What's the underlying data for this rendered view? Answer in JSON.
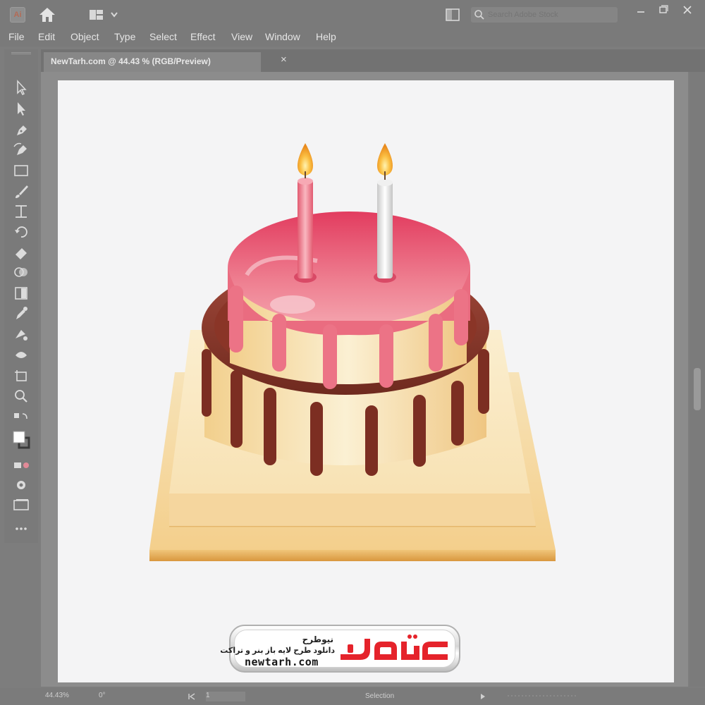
{
  "app": {
    "logo_text": "Ai"
  },
  "search": {
    "placeholder": "Search Adobe Stock"
  },
  "menu": [
    "File",
    "Edit",
    "Object",
    "Type",
    "Select",
    "Effect",
    "View",
    "Window",
    "Help"
  ],
  "document": {
    "tab_label": "NewTarh.com @ 44.43 % (RGB/Preview)",
    "close_glyph": "×"
  },
  "tools": [
    "selection-tool",
    "direct-selection-tool",
    "pen-tool",
    "curvature-tool",
    "rectangle-tool",
    "paintbrush-tool",
    "width-tool",
    "rotate-tool",
    "eraser-tool",
    "shape-builder-tool",
    "gradient-tool",
    "eyedropper-tool",
    "blend-tool",
    "symbol-sprayer-tool",
    "artboard-tool",
    "zoom-tool",
    "swap-colors-icon",
    "fill-stroke-swatch",
    "color-mode-icon",
    "draw-mode-icon",
    "screen-mode-icon",
    "more-tools-icon"
  ],
  "status": {
    "zoom": "44.43%",
    "rotation": "0°",
    "page": "1",
    "mode": "Selection"
  },
  "watermark": {
    "title": "نیوطرح",
    "tagline": "دانلود طرح لایه باز بنر و تراکت",
    "url": "newtarh.com",
    "brand_color": "#e5232b"
  },
  "colors": {
    "chrome": "#7a7a7a",
    "artboard": "#f4f4f5",
    "icing_pink": "#e95a73",
    "chocolate": "#8a3527",
    "cream": "#f7e6c2",
    "board_gold": "#e7b463",
    "candle_pink": "#f08a99",
    "candle_white": "#e8e8e8",
    "flame": "#f6a623"
  }
}
